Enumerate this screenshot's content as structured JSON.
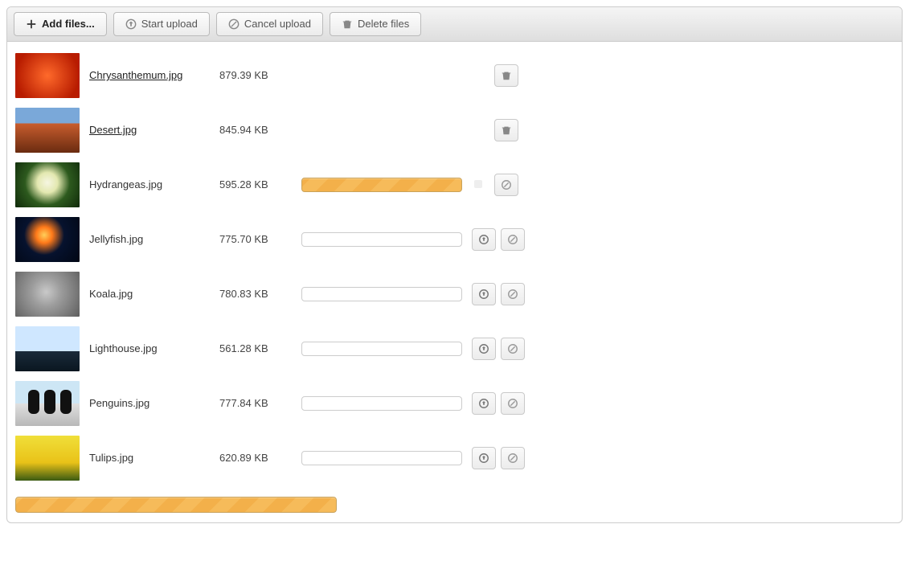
{
  "toolbar": {
    "add_label": "Add files...",
    "start_label": "Start upload",
    "cancel_label": "Cancel upload",
    "delete_label": "Delete files"
  },
  "files": [
    {
      "name": "Chrysanthemum.jpg",
      "size": "879.39 KB",
      "state": "done"
    },
    {
      "name": "Desert.jpg",
      "size": "845.94 KB",
      "state": "done"
    },
    {
      "name": "Hydrangeas.jpg",
      "size": "595.28 KB",
      "state": "uploading"
    },
    {
      "name": "Jellyfish.jpg",
      "size": "775.70 KB",
      "state": "queued"
    },
    {
      "name": "Koala.jpg",
      "size": "780.83 KB",
      "state": "queued"
    },
    {
      "name": "Lighthouse.jpg",
      "size": "561.28 KB",
      "state": "queued"
    },
    {
      "name": "Penguins.jpg",
      "size": "777.84 KB",
      "state": "queued"
    },
    {
      "name": "Tulips.jpg",
      "size": "620.89 KB",
      "state": "queued"
    }
  ],
  "icons": {
    "plus": "plus-icon",
    "upload": "upload-circle-icon",
    "cancel": "cancel-circle-icon",
    "trash": "trash-icon"
  },
  "total_progress_percent": 100
}
